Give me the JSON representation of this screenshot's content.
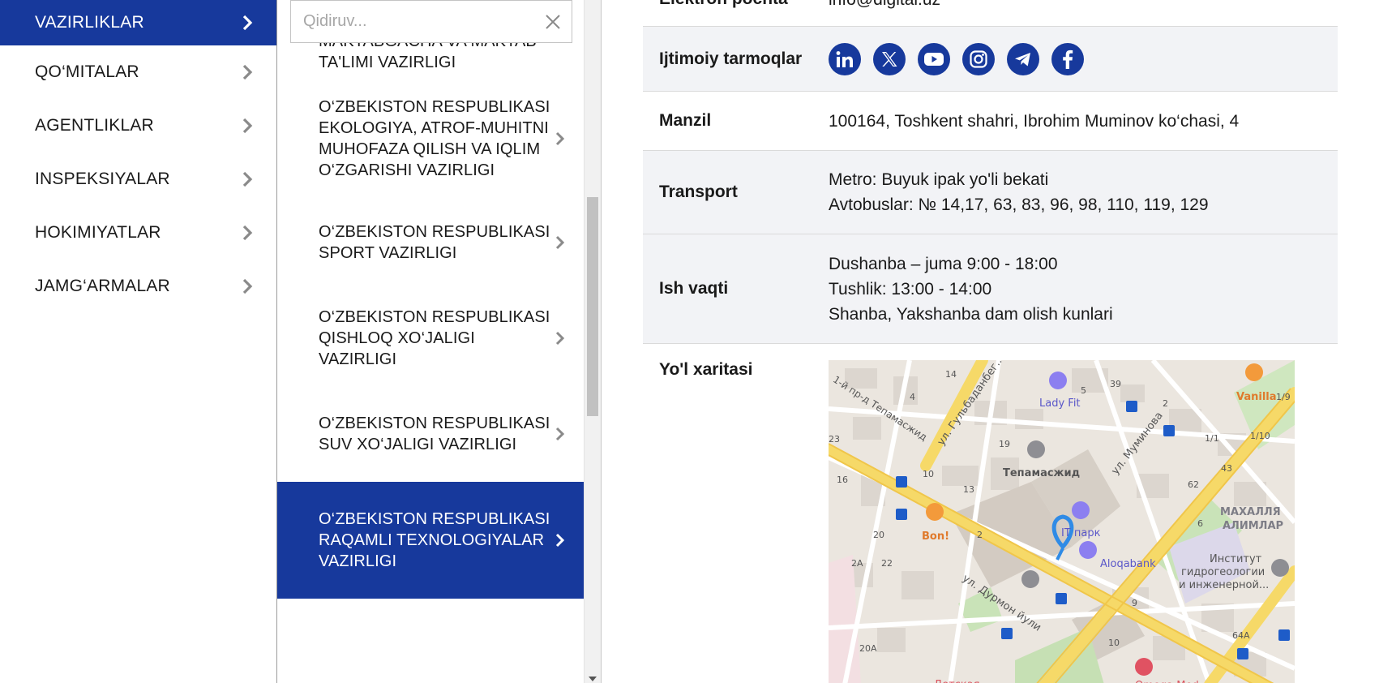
{
  "categories": [
    {
      "label": "VAZIRLIKLAR",
      "active": true
    },
    {
      "label": "QO‘MITALAR",
      "active": false
    },
    {
      "label": "AGENTLIKLAR",
      "active": false
    },
    {
      "label": "INSPEKSIYALAR",
      "active": false
    },
    {
      "label": "HOKIMIYATLAR",
      "active": false
    },
    {
      "label": "JAMG‘ARMALAR",
      "active": false
    }
  ],
  "search": {
    "placeholder": "Qidiruv...",
    "value": ""
  },
  "ministries": [
    {
      "label": "Maktabgacha va maktab ta'limi vazirligi"
    },
    {
      "label": "O‘zbekiston Respublikasi Ekologiya, atrof-muhitni muhofaza qilish va iqlim o‘zgarishi vazirligi"
    },
    {
      "label": "O‘zbekiston Respublikasi Sport vazirligi"
    },
    {
      "label": "O‘zbekiston Respublikasi Qishloq xo‘jaligi vazirligi"
    },
    {
      "label": "O‘zbekiston Respublikasi Suv xo‘jaligi vazirligi"
    },
    {
      "label": "O‘zbekiston Respublikasi Raqamli texnologiyalar vazirligi"
    }
  ],
  "details": {
    "email": {
      "key": "Elektron pochta",
      "value": "info@digital.uz"
    },
    "social": {
      "key": "Ijtimoiy tarmoqlar",
      "icons": [
        "linkedin-icon",
        "x-twitter-icon",
        "youtube-icon",
        "instagram-icon",
        "telegram-icon",
        "facebook-icon"
      ]
    },
    "address": {
      "key": "Manzil",
      "value": "100164, Toshkent shahri, Ibrohim Muminov ko‘chasi, 4"
    },
    "transport": {
      "key": "Transport",
      "lines": [
        "Metro: Buyuk ipak yo'li bekati",
        "Avtobuslar: № 14,17, 63, 83, 96, 98, 110, 119, 129"
      ]
    },
    "hours": {
      "key": "Ish vaqti",
      "lines": [
        "Dushanba – juma 9:00 - 18:00",
        "Tushlik: 13:00 - 14:00",
        "Shanba, Yakshanba dam olish kunlari"
      ]
    },
    "map": {
      "key": "Yo'l xaritasi"
    }
  },
  "map_labels": {
    "lady_fit": "Lady Fit",
    "vanilla": "Vanilla",
    "tepamasjid": "Тепамасжид",
    "bon": "Bon!",
    "it_park": "IT парк",
    "aloqabank": "Aloqabank",
    "mahallya": "МАХАЛЛЯ",
    "alimlar": "АЛИМЛАР",
    "institute1": "Институт",
    "institute2": "гидрогеологии",
    "institute3": "и инженерной...",
    "st_muminova": "ул. Муминова",
    "st_gulbadanbegim": "ул. Гульбаданбег...",
    "st_durmon": "ул. Дурмон йули",
    "st_tepamasjid": "1-й пр-д Тепамасжид",
    "detskaya": "Детская...",
    "omega": "Omega Med",
    "houses": [
      "14",
      "4",
      "5",
      "39",
      "2",
      "1/1",
      "1/10",
      "23",
      "19",
      "43",
      "62",
      "16",
      "10",
      "13",
      "6",
      "20",
      "2",
      "2A",
      "22",
      "9",
      "20A",
      "10",
      "64A",
      "1/9"
    ]
  },
  "colors": {
    "accent": "#17399c",
    "row_shade": "#f2f3f6"
  }
}
